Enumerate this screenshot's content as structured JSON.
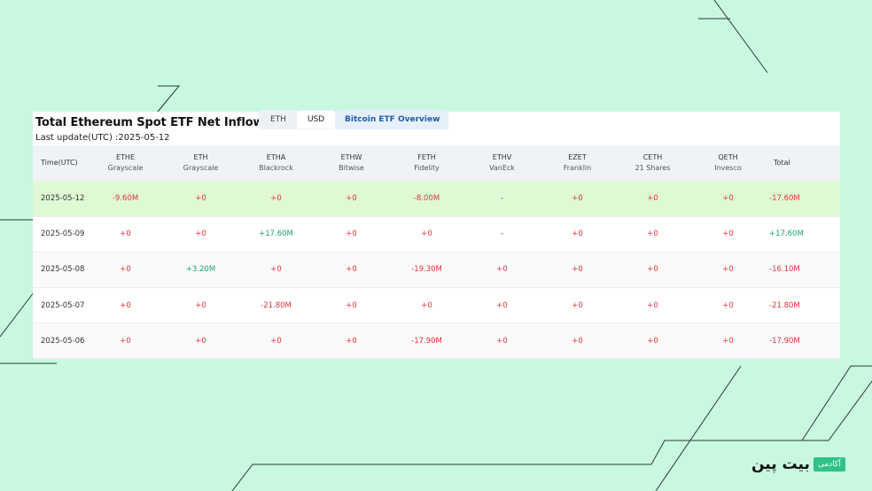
{
  "header": {
    "title": "Total Ethereum Spot ETF Net Inflow USD",
    "last_update": "Last update(UTC) :2025-05-12",
    "toggle": {
      "eth": "ETH",
      "usd": "USD",
      "active": "USD"
    },
    "bitcoin_button": "Bitcoin ETF Overview"
  },
  "columns": [
    {
      "ticker": "Time(UTC)",
      "issuer": ""
    },
    {
      "ticker": "ETHE",
      "issuer": "Grayscale"
    },
    {
      "ticker": "ETH",
      "issuer": "Grayscale"
    },
    {
      "ticker": "ETHA",
      "issuer": "Blackrock"
    },
    {
      "ticker": "ETHW",
      "issuer": "Bitwise"
    },
    {
      "ticker": "FETH",
      "issuer": "Fidelity"
    },
    {
      "ticker": "ETHV",
      "issuer": "VanEck"
    },
    {
      "ticker": "EZET",
      "issuer": "Franklin"
    },
    {
      "ticker": "CETH",
      "issuer": "21 Shares"
    },
    {
      "ticker": "QETH",
      "issuer": "Invesco"
    },
    {
      "ticker": "Total",
      "issuer": ""
    }
  ],
  "rows": [
    {
      "date": "2025-05-12",
      "cells": [
        "-9.60M",
        "+0",
        "+0",
        "+0",
        "-8.00M",
        "-",
        "+0",
        "+0",
        "+0",
        "-17.60M"
      ]
    },
    {
      "date": "2025-05-09",
      "cells": [
        "+0",
        "+0",
        "+17.60M",
        "+0",
        "+0",
        "-",
        "+0",
        "+0",
        "+0",
        "+17.60M"
      ]
    },
    {
      "date": "2025-05-08",
      "cells": [
        "+0",
        "+3.20M",
        "+0",
        "+0",
        "-19.30M",
        "+0",
        "+0",
        "+0",
        "+0",
        "-16.10M"
      ]
    },
    {
      "date": "2025-05-07",
      "cells": [
        "+0",
        "+0",
        "-21.80M",
        "+0",
        "+0",
        "+0",
        "+0",
        "+0",
        "+0",
        "-21.80M"
      ]
    },
    {
      "date": "2025-05-06",
      "cells": [
        "+0",
        "+0",
        "+0",
        "+0",
        "-17.90M",
        "+0",
        "+0",
        "+0",
        "+0",
        "-17.90M"
      ]
    }
  ],
  "brand": {
    "name": "بیت پین",
    "tag": "آکادمی"
  },
  "colors": {
    "negative": "#e0353f",
    "positive": "#1aa37a",
    "highlight_row": "#e0f9d5",
    "background": "#c8f8e0"
  }
}
